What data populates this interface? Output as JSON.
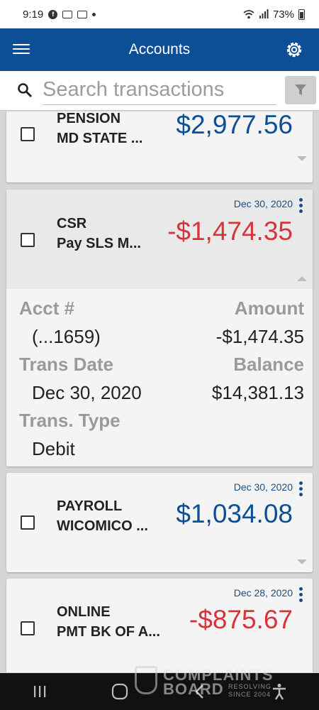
{
  "status_bar": {
    "time": "9:19",
    "battery": "73%"
  },
  "app_bar": {
    "title": "Accounts"
  },
  "search": {
    "placeholder": "Search transactions"
  },
  "transactions": [
    {
      "desc_line1": "PENSION",
      "desc_line2": "MD STATE ...",
      "amount": "$2,977.56",
      "date": ""
    },
    {
      "desc_line1": "CSR",
      "desc_line2": "Pay SLS M...",
      "amount": "-$1,474.35",
      "date": "Dec 30, 2020",
      "details": {
        "acct_label": "Acct #",
        "acct_value": "(...1659)",
        "amount_label": "Amount",
        "amount_value": "-$1,474.35",
        "date_label": "Trans Date",
        "date_value": "Dec 30, 2020",
        "balance_label": "Balance",
        "balance_value": "$14,381.13",
        "type_label": "Trans. Type",
        "type_value": "Debit"
      }
    },
    {
      "desc_line1": "PAYROLL",
      "desc_line2": "WICOMICO ...",
      "amount": "$1,034.08",
      "date": "Dec 30, 2020"
    },
    {
      "desc_line1": "ONLINE",
      "desc_line2": "PMT BK OF A...",
      "amount": "-$875.67",
      "date": "Dec 28, 2020"
    }
  ],
  "watermark": {
    "line1": "COMPLAINTS",
    "line2": "BOARD",
    "line3": "RESOLVING SINCE 2004"
  },
  "colors": {
    "brand": "#0d4f97",
    "positive": "#0d4f97",
    "negative": "#d7333a"
  }
}
